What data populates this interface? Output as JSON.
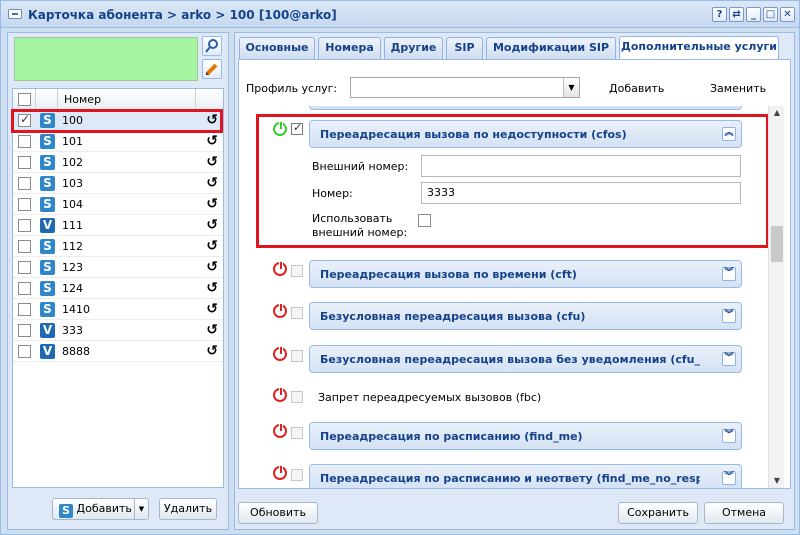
{
  "window": {
    "title": "Карточка абонента > arko > 100 [100@arko]",
    "buttons": [
      "?",
      "⇄",
      "_",
      "□",
      "✕"
    ]
  },
  "left": {
    "grid": {
      "header": "Номер",
      "rows": [
        {
          "number": "100",
          "type": "S",
          "checked": true,
          "selected": true
        },
        {
          "number": "101",
          "type": "S",
          "checked": false
        },
        {
          "number": "102",
          "type": "S",
          "checked": false
        },
        {
          "number": "103",
          "type": "S",
          "checked": false
        },
        {
          "number": "104",
          "type": "S",
          "checked": false
        },
        {
          "number": "111",
          "type": "V",
          "checked": false
        },
        {
          "number": "112",
          "type": "S",
          "checked": false
        },
        {
          "number": "123",
          "type": "S",
          "checked": false
        },
        {
          "number": "124",
          "type": "S",
          "checked": false
        },
        {
          "number": "1410",
          "type": "S",
          "checked": false
        },
        {
          "number": "333",
          "type": "V",
          "checked": false
        },
        {
          "number": "8888",
          "type": "V",
          "checked": false
        }
      ]
    },
    "add_label": "Добавить",
    "delete_label": "Удалить"
  },
  "tabs": [
    "Основные",
    "Номера",
    "Другие",
    "SIP",
    "Модификации SIP",
    "Дополнительные услуги"
  ],
  "active_tab": 5,
  "profile": {
    "label": "Профиль услуг:",
    "value": "",
    "add": "Добавить",
    "replace": "Заменить"
  },
  "services": {
    "cfos": {
      "title": "Переадресация вызова по недоступности (cfos)",
      "enabled": true,
      "checked": true,
      "external_label": "Внешний номер:",
      "external_value": "",
      "number_label": "Номер:",
      "number_value": "3333",
      "use_external_label_1": "Использовать",
      "use_external_label_2": "внешний номер:",
      "use_external_checked": false
    },
    "collapsed": [
      "Переадресация вызова по времени (cft)",
      "Безусловная переадресация вызова (cfu)",
      "Безусловная переадресация вызова без уведомления (cfu_typ",
      "Запрет переадресуемых вызовов (fbc)",
      "Переадресация по расписанию (find_me)",
      "Переадресация по расписанию и неответу (find_me_no_respo"
    ]
  },
  "footer": {
    "refresh": "Обновить",
    "save": "Сохранить",
    "cancel": "Отмена"
  }
}
